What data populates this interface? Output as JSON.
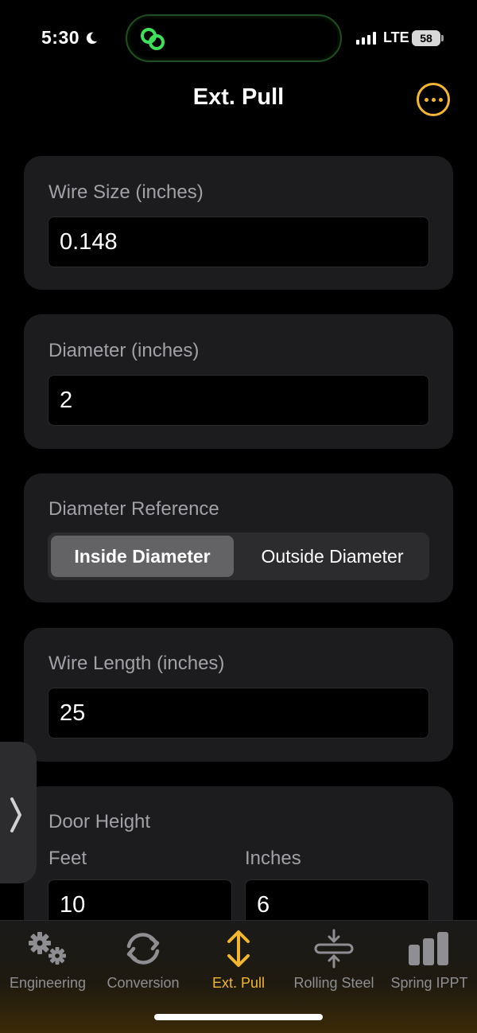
{
  "status_bar": {
    "time": "5:30",
    "network": "LTE",
    "battery": "58"
  },
  "nav": {
    "title": "Ext. Pull",
    "more_icon": "ellipsis-circle-icon",
    "accent_color": "#f2b630"
  },
  "wire_size": {
    "label": "Wire Size (inches)",
    "value": "0.148"
  },
  "diameter": {
    "label": "Diameter (inches)",
    "value": "2"
  },
  "diameter_reference": {
    "label": "Diameter Reference",
    "options": [
      "Inside Diameter",
      "Outside Diameter"
    ],
    "selected": "Inside Diameter"
  },
  "wire_length": {
    "label": "Wire Length (inches)",
    "value": "25"
  },
  "door_height": {
    "label": "Door Height",
    "feet_label": "Feet",
    "feet_value": "10",
    "inches_label": "Inches",
    "inches_value": "6"
  },
  "tabs": [
    {
      "label": "Engineering",
      "icon": "gears-icon",
      "active": false
    },
    {
      "label": "Conversion",
      "icon": "refresh-icon",
      "active": false
    },
    {
      "label": "Ext. Pull",
      "icon": "vertical-arrows-icon",
      "active": true
    },
    {
      "label": "Rolling Steel",
      "icon": "compress-icon",
      "active": false
    },
    {
      "label": "Spring IPPT",
      "icon": "bar-chart-icon",
      "active": false
    }
  ]
}
